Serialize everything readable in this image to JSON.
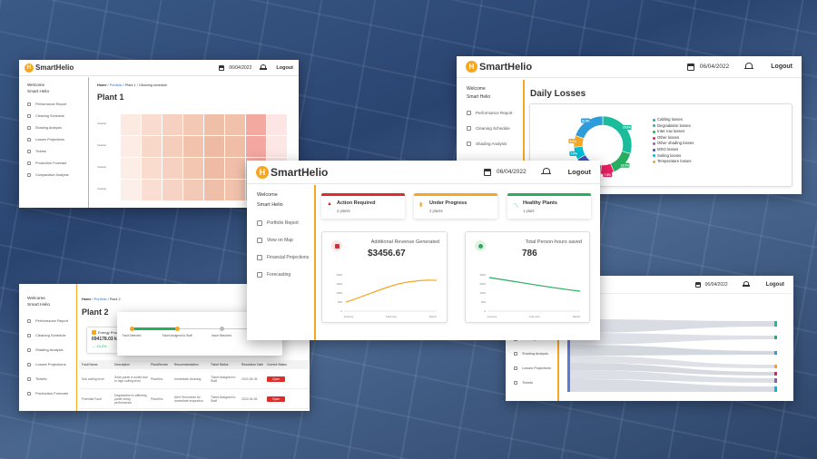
{
  "app": {
    "brand": "SmartHelio",
    "date": "06/04/2022",
    "logout": "Logout",
    "welcome": "Welcome",
    "user": "Smart Helio"
  },
  "plant1": {
    "date": "06/04/2022",
    "breadcrumb": {
      "home": "Home",
      "sep1": " / ",
      "portfolio": "Portfolio",
      "rest": " / Plant 1 / Cleaning schedule"
    },
    "title": "Plant 1",
    "nav": [
      "Performance Report",
      "Cleaning Schedule",
      "Shading Analysis",
      "Losses Projections",
      "Tickets",
      "Production Forecast",
      "Comparative Analysis"
    ],
    "row_labels": [
      "Inverter",
      "Inverter",
      "Inverter",
      "Inverter"
    ]
  },
  "daily": {
    "date": "06/04/2022",
    "title": "Daily Losses",
    "nav": [
      "Performance Report",
      "Cleaning Schedule",
      "Shading Analysis"
    ],
    "legend": [
      {
        "label": "Cabling losses",
        "color": "#2d9cdb"
      },
      {
        "label": "Degradation losses",
        "color": "#1abc9c"
      },
      {
        "label": "Inter row losses",
        "color": "#27ae60"
      },
      {
        "label": "Other losses",
        "color": "#e91e63"
      },
      {
        "label": "Other shading losses",
        "color": "#9b59b6"
      },
      {
        "label": "MSO losses",
        "color": "#3f51b5"
      },
      {
        "label": "Soiling losses",
        "color": "#00bcd4"
      },
      {
        "label": "Temperature losses",
        "color": "#f5a623"
      }
    ],
    "donut": [
      {
        "value": 29.8,
        "color": "#1abc9c",
        "label": "29.8%"
      },
      {
        "value": 13.9,
        "color": "#27ae60",
        "label": "13.9%"
      },
      {
        "value": 7.5,
        "color": "#e91e63",
        "label": "7.5%"
      },
      {
        "value": 7.6,
        "color": "#9b59b6",
        "label": "7.6%"
      },
      {
        "value": 8.1,
        "color": "#3f51b5",
        "label": "8.1%"
      },
      {
        "value": 7.0,
        "color": "#00bcd4",
        "label": "7.0%"
      },
      {
        "value": 6.5,
        "color": "#f5a623",
        "label": "6.5%"
      },
      {
        "value": 19.6,
        "color": "#2d9cdb",
        "label": "19.6%"
      }
    ]
  },
  "main": {
    "date": "06/04/2022",
    "nav": [
      "Portfolio Report",
      "View on Map",
      "Financial Projections",
      "Forecasting"
    ],
    "status": [
      {
        "title": "Action Required",
        "sub": "2 plants",
        "color": "#e02b2b"
      },
      {
        "title": "Under Progress",
        "sub": "2 plants",
        "color": "#f5a623"
      },
      {
        "title": "Healthy Plants",
        "sub": "1 plant",
        "color": "#27ae60"
      }
    ],
    "revenue": {
      "title": "Additional Revenue Generated",
      "value": "$3456.67"
    },
    "hours": {
      "title": "Total Person-hours saved",
      "value": "786"
    }
  },
  "plant2": {
    "breadcrumb": {
      "home": "Home",
      "sep1": " / ",
      "portfolio": "Portfolio",
      "rest": " / Plant 2"
    },
    "title": "Plant 2",
    "nav": [
      "Performance Report",
      "Cleaning Schedule",
      "Shading Analysis",
      "Losses Projections",
      "Tickets",
      "Production Forecast"
    ],
    "energy_label": "Energy Producti",
    "energy_value": "694178.03 kW",
    "energy_delta": "→ 13.2%",
    "timeline": [
      "Fault Detected",
      "Ticket Assigned to Staff",
      "Issue Resolved"
    ],
    "table_headers": [
      "Fault Name",
      "Description",
      "Plant/Device",
      "Recommendation",
      "Ticket Status",
      "Resolution Date",
      "Current Status"
    ],
    "rows": [
      {
        "name": "Sub soiling level",
        "desc": "Solar panel is soiled due to high soiling level",
        "device": "Plant/Inv.",
        "rec": "Immediate cleaning",
        "status": "Ticket Assigned to Staff",
        "date": "2022-06-05",
        "btn": "Open"
      },
      {
        "name": "Potential Fault",
        "desc": "Degradation is affecting panel string performance",
        "device": "Plant/Inv.",
        "rec": "Alert Technician for immediate inspection",
        "status": "Ticket Assigned to Staff",
        "date": "2022-06-06",
        "btn": "Open"
      }
    ]
  },
  "sankey": {
    "date": "06/04/2022",
    "nav": [
      "Cleaning Schedule",
      "Shading Analysis",
      "Losses Projections",
      "Tickets"
    ]
  }
}
